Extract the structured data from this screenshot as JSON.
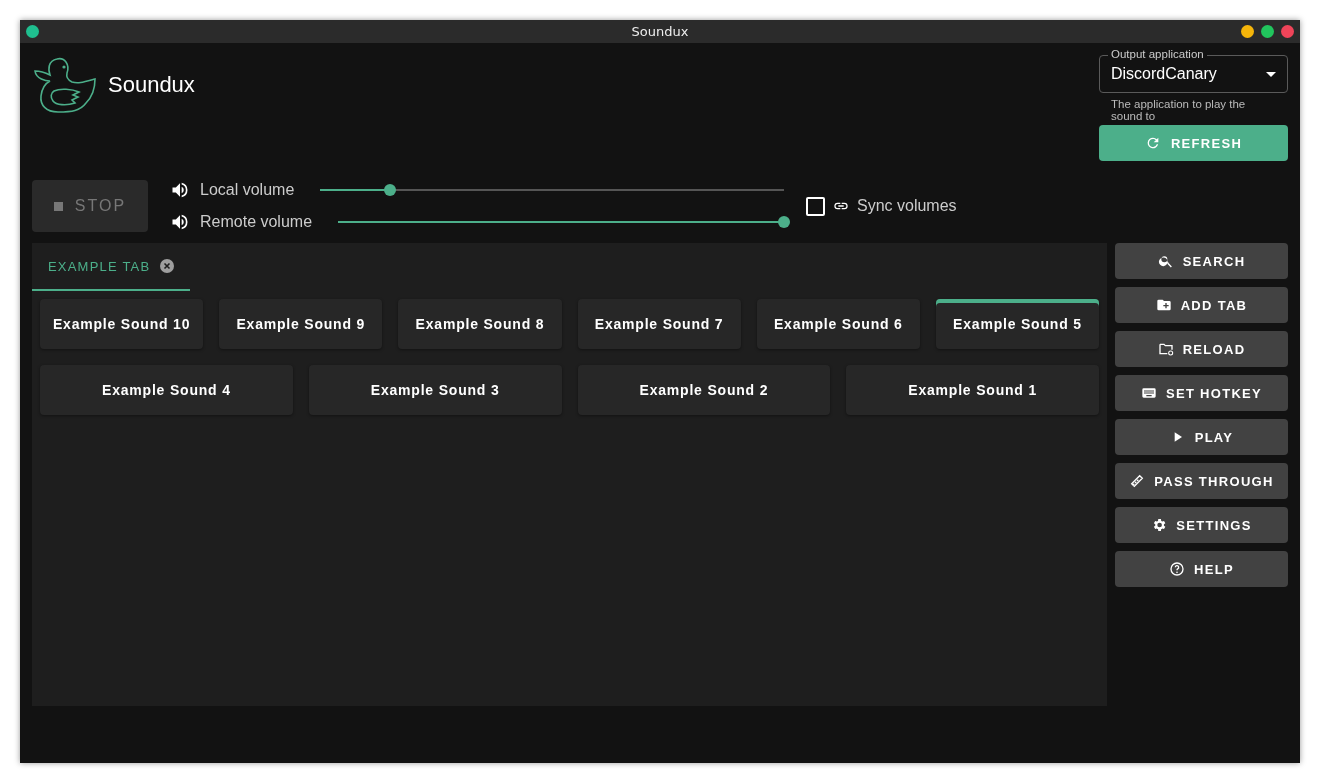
{
  "window": {
    "title": "Soundux"
  },
  "app_title": "Soundux",
  "output": {
    "label": "Output application",
    "value": "DiscordCanary",
    "hint": "The application to play the sound to"
  },
  "refresh_button": "REFRESH",
  "stop_button": {
    "label": "STOP",
    "disabled": true
  },
  "volumes": [
    {
      "label": "Local volume",
      "level": 0.15
    },
    {
      "label": "Remote volume",
      "level": 1.0
    }
  ],
  "sync": {
    "label": "Sync volumes",
    "checked": false
  },
  "tabs": [
    {
      "label": "EXAMPLE TAB",
      "selected": true
    }
  ],
  "sound_rows": [
    [
      {
        "name": "Example Sound 10",
        "selected": false
      },
      {
        "name": "Example Sound 9",
        "selected": false
      },
      {
        "name": "Example Sound 8",
        "selected": false
      },
      {
        "name": "Example Sound 7",
        "selected": false
      },
      {
        "name": "Example Sound 6",
        "selected": false
      },
      {
        "name": "Example Sound 5",
        "selected": true
      }
    ],
    [
      {
        "name": "Example Sound 4",
        "selected": false
      },
      {
        "name": "Example Sound 3",
        "selected": false
      },
      {
        "name": "Example Sound 2",
        "selected": false
      },
      {
        "name": "Example Sound 1",
        "selected": false
      }
    ]
  ],
  "actions": [
    {
      "kind": "search",
      "label": "SEARCH"
    },
    {
      "kind": "add-tab",
      "label": "ADD TAB"
    },
    {
      "kind": "reload",
      "label": "RELOAD"
    },
    {
      "kind": "hotkey",
      "label": "SET HOTKEY"
    },
    {
      "kind": "play",
      "label": "PLAY"
    },
    {
      "kind": "pass",
      "label": "PASS THROUGH"
    },
    {
      "kind": "settings",
      "label": "SETTINGS"
    },
    {
      "kind": "help",
      "label": "HELP"
    }
  ]
}
